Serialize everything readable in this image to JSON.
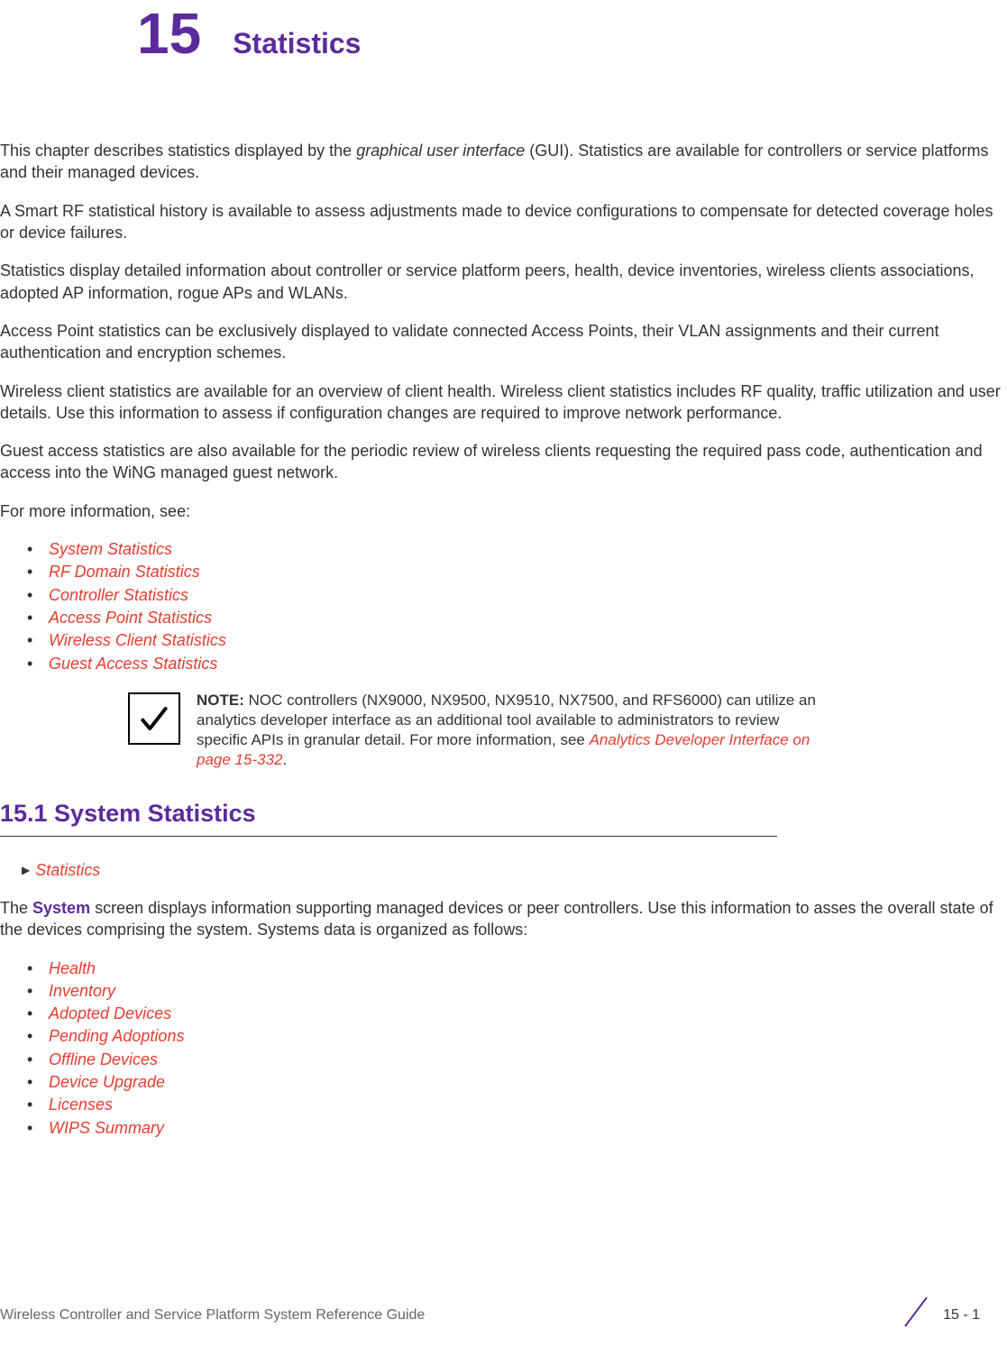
{
  "chapter": {
    "number": "15",
    "title": "Statistics"
  },
  "paragraphs": {
    "p1_a": "This chapter describes statistics displayed by the ",
    "p1_em": "graphical user interface",
    "p1_b": " (GUI). Statistics are available for controllers or service platforms and their managed devices.",
    "p2": "A Smart RF statistical history is available to assess adjustments made to device configurations to compensate for detected coverage holes or device failures.",
    "p3": "Statistics display detailed information about controller or service platform peers, health, device inventories, wireless clients associations, adopted AP information, rogue APs and WLANs.",
    "p4": "Access Point statistics can be exclusively displayed to validate connected Access Points, their VLAN assignments and their current authentication and encryption schemes.",
    "p5": "Wireless client statistics are available for an overview of client health. Wireless client statistics includes RF quality, traffic utilization and user details. Use this information to assess if configuration changes are required to improve network performance.",
    "p6": "Guest access statistics are also available for the periodic review of wireless clients requesting the required pass code, authentication and access into the WiNG managed guest network.",
    "p7": "For more information, see:"
  },
  "topLinks": [
    "System Statistics",
    "RF Domain Statistics",
    "Controller Statistics",
    "Access Point Statistics",
    "Wireless Client Statistics",
    "Guest Access Statistics"
  ],
  "note": {
    "label": "NOTE:",
    "text": " NOC controllers (NX9000, NX9500, NX9510, NX7500, and RFS6000) can utilize an analytics developer interface as an additional tool available to administrators to review specific APIs in granular detail. For more information, see ",
    "link": "Analytics Developer Interface on page 15-332",
    "after": "."
  },
  "section": {
    "heading": "15.1 System Statistics",
    "breadcrumb": "Statistics",
    "intro_a": "The ",
    "intro_strong": "System",
    "intro_b": " screen displays information supporting managed devices or peer controllers. Use this information to asses the overall state of the devices comprising the system. Systems data is organized as follows:"
  },
  "sectionLinks": [
    "Health",
    "Inventory",
    "Adopted Devices",
    "Pending Adoptions",
    "Offline Devices",
    "Device Upgrade",
    "Licenses",
    "WIPS Summary"
  ],
  "footer": {
    "left": "Wireless Controller and Service Platform System Reference Guide",
    "pagenum": "15 - 1"
  }
}
